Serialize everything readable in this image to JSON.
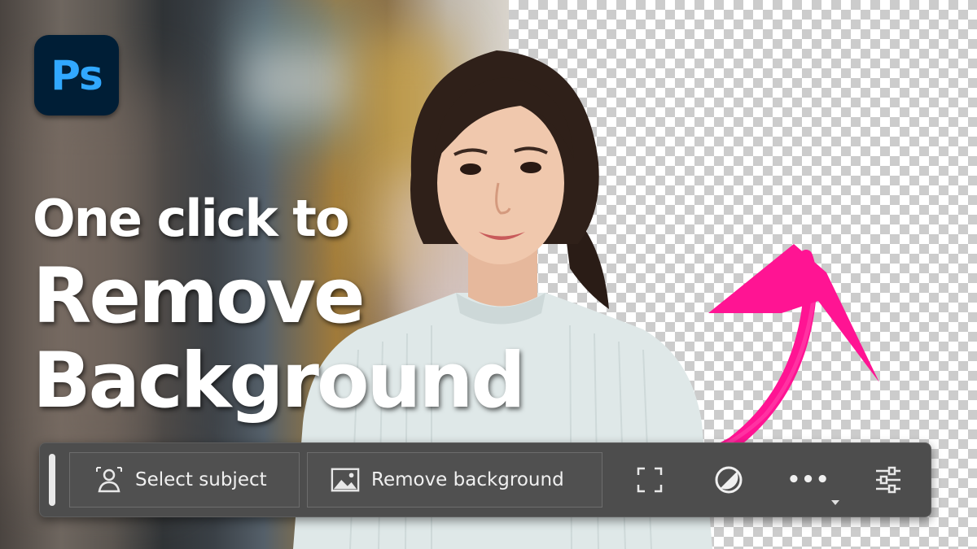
{
  "logo": {
    "text": "Ps",
    "bg_color": "#001e36",
    "text_color": "#31a8ff"
  },
  "headline": {
    "line1": "One click to",
    "line2": "Remove",
    "line3": "Background"
  },
  "taskbar": {
    "select_subject_label": "Select subject",
    "remove_background_label": "Remove background",
    "more_label": "•••",
    "icons": [
      "person-select-icon",
      "image-icon",
      "expand-icon",
      "contrast-circle-icon",
      "more-icon",
      "sliders-icon"
    ]
  },
  "colors": {
    "accent_arrow": "#ff1493",
    "taskbar_bg": "#4d4d4d"
  }
}
